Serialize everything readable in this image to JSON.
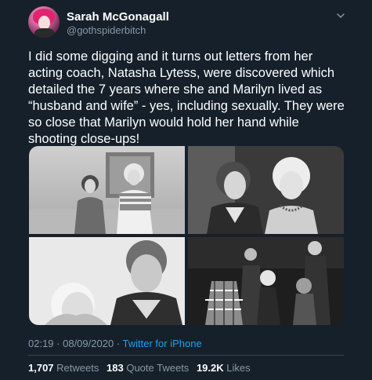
{
  "user": {
    "display_name": "Sarah McGonagall",
    "handle": "@gothspiderbitch"
  },
  "icons": {
    "avatar": "profile-avatar",
    "menu": "chevron-down-icon"
  },
  "tweet": {
    "text": "I did some digging and it turns out letters from her acting coach, Natasha Lytess, were discovered which detailed the 7 years where she and Marilyn lived as “husband and wife” - yes, including sexually. They were so close that Marilyn would hold her hand while shooting close-ups!"
  },
  "meta": {
    "time": "02:19",
    "separator1": " · ",
    "date": "08/09/2020",
    "separator2": " · ",
    "source": "Twitter for iPhone"
  },
  "stats": {
    "retweets_count": "1,707",
    "retweets_label": "Retweets",
    "quotes_count": "183",
    "quotes_label": "Quote Tweets",
    "likes_count": "19.2K",
    "likes_label": "Likes"
  },
  "colors": {
    "background": "#15202b",
    "secondary_text": "#8899a6",
    "link": "#1da1f2",
    "divider": "#38444d"
  }
}
